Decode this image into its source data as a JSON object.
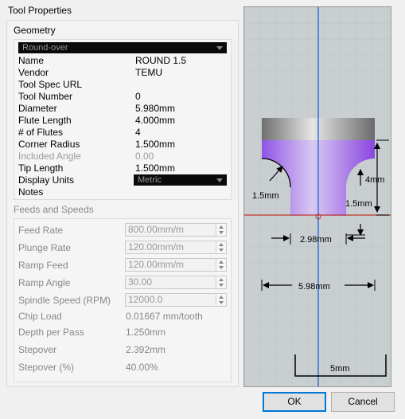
{
  "window": {
    "title": "Tool Properties"
  },
  "geometry": {
    "legend": "Geometry",
    "profile": "Round-over",
    "rows": [
      {
        "label": "Name",
        "value": "ROUND 1.5",
        "dim": false
      },
      {
        "label": "Vendor",
        "value": "TEMU",
        "dim": false
      },
      {
        "label": "Tool Spec URL",
        "value": "",
        "dim": false
      },
      {
        "label": "Tool Number",
        "value": "0",
        "dim": false
      },
      {
        "label": "Diameter",
        "value": "5.980mm",
        "dim": false
      },
      {
        "label": "Flute Length",
        "value": "4.000mm",
        "dim": false
      },
      {
        "label": "# of Flutes",
        "value": "4",
        "dim": false
      },
      {
        "label": "Corner Radius",
        "value": "1.500mm",
        "dim": false
      },
      {
        "label": "Included Angle",
        "value": "0.00",
        "dim": true
      },
      {
        "label": "Tip Length",
        "value": "1.500mm",
        "dim": false
      },
      {
        "label": "Display Units",
        "value": "",
        "dim": false
      },
      {
        "label": "Notes",
        "value": "",
        "dim": false
      }
    ],
    "display_units": "Metric"
  },
  "feeds": {
    "legend": "Feeds and Speeds",
    "spin_rows": [
      {
        "label": "Feed Rate",
        "value": "800.00mm/m"
      },
      {
        "label": "Plunge Rate",
        "value": "120.00mm/m"
      },
      {
        "label": "Ramp Feed",
        "value": "120.00mm/m"
      },
      {
        "label": "Ramp Angle",
        "value": "30.00"
      },
      {
        "label": "Spindle Speed (RPM)",
        "value": "12000.0"
      }
    ],
    "text_rows": [
      {
        "label": "Chip Load",
        "value": "0.01667 mm/tooth"
      },
      {
        "label": "Depth per Pass",
        "value": "1.250mm"
      },
      {
        "label": "Stepover",
        "value": "2.392mm"
      },
      {
        "label": "Stepover (%)",
        "value": "40.00%"
      }
    ]
  },
  "preview": {
    "dims": {
      "corner_radius": "1.5mm",
      "flute_length": "4mm",
      "tip_length": "1.5mm",
      "tip_width": "2.98mm",
      "diameter": "5.98mm",
      "scale": "5mm"
    },
    "colors": {
      "background": "#c9ced0",
      "grid": "#b5babd",
      "center_line": "#2f6bd0",
      "base_line": "#c0392b",
      "tool_purple": "#a070e8",
      "shank_gray": "#8a8a8a"
    }
  },
  "buttons": {
    "ok": "OK",
    "cancel": "Cancel"
  }
}
